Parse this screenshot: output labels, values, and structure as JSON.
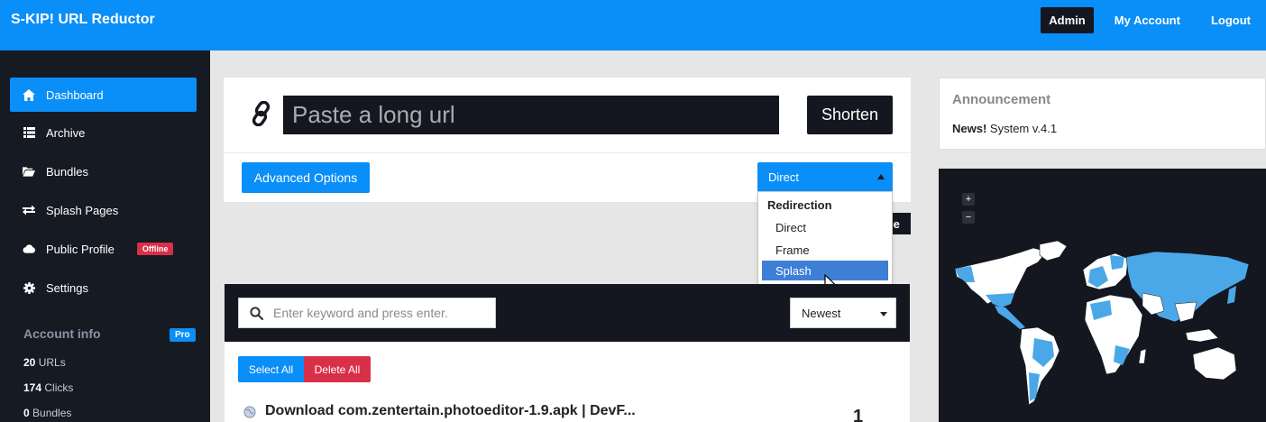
{
  "brand": "S-KIP! URL Reductor",
  "topnav": {
    "admin": "Admin",
    "account": "My Account",
    "logout": "Logout"
  },
  "sidebar": {
    "items": [
      {
        "label": "Dashboard",
        "icon": "home-icon"
      },
      {
        "label": "Archive",
        "icon": "list-icon"
      },
      {
        "label": "Bundles",
        "icon": "folder-open-icon"
      },
      {
        "label": "Splash Pages",
        "icon": "exchange-icon"
      },
      {
        "label": "Public Profile",
        "icon": "cloud-icon",
        "badge": "Offline"
      },
      {
        "label": "Settings",
        "icon": "gear-icon"
      }
    ],
    "account_title": "Account info",
    "account_badge": "Pro",
    "stats": [
      {
        "value": "20",
        "label": "URLs"
      },
      {
        "value": "174",
        "label": "Clicks"
      },
      {
        "value": "0",
        "label": "Bundles"
      }
    ]
  },
  "shorten": {
    "placeholder": "Paste a long url",
    "button": "Shorten",
    "advanced": "Advanced Options",
    "redirect_selected": "Direct"
  },
  "dropdown": {
    "group": "Redirection",
    "options": [
      "Direct",
      "Frame",
      "Splash"
    ],
    "highlighted": "Splash"
  },
  "bubble_button_fragment": "le",
  "links": {
    "search_placeholder": "Enter keyword and press enter.",
    "sort": "Newest",
    "select_all": "Select All",
    "delete_all": "Delete All",
    "first_title": "Download com.zentertain.photoeditor-1.9.apk | DevF...",
    "first_clicks": "1"
  },
  "announcement": {
    "title": "Announcement",
    "news_label": "News!",
    "news_text": "System v.4.1"
  },
  "map": {
    "zoom_in": "+",
    "zoom_out": "−"
  },
  "colors": {
    "primary": "#0a8ef7",
    "dark": "#14171f",
    "danger": "#d9304a",
    "map_highlight": "#4aa8e8"
  }
}
